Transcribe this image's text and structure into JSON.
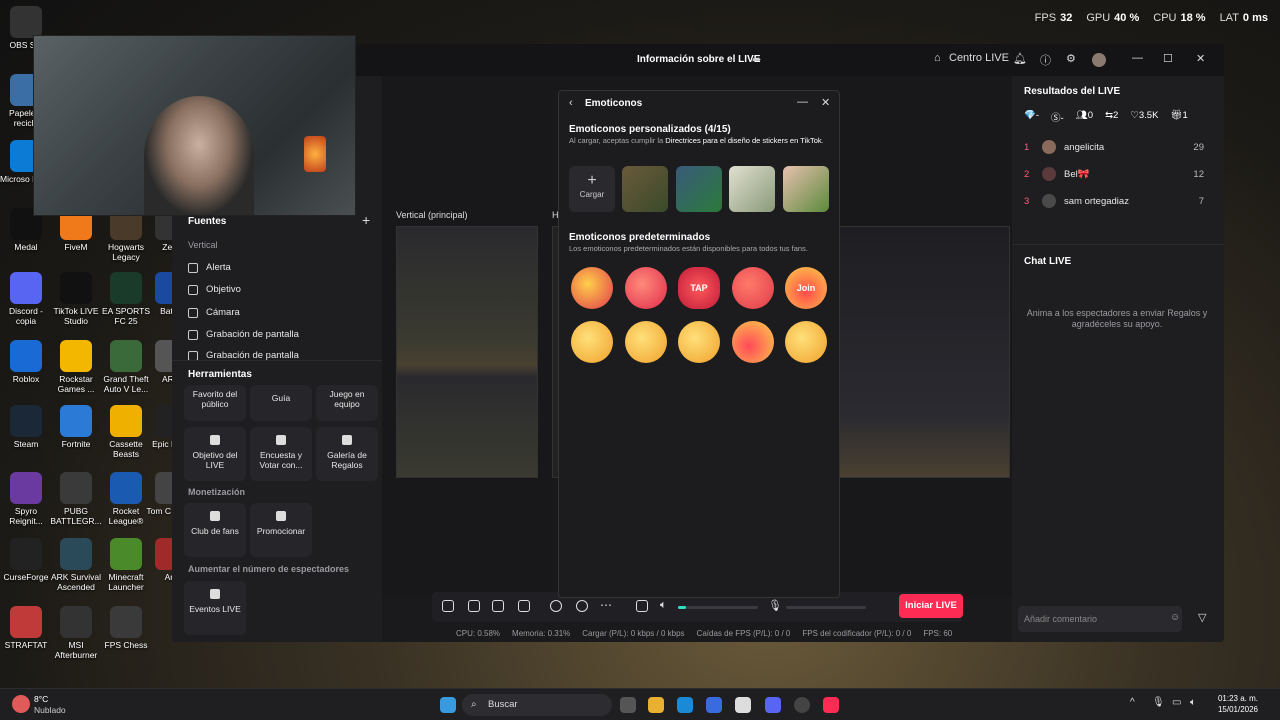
{
  "perf": {
    "fps_label": "FPS",
    "fps_value": "32",
    "gpu_label": "GPU",
    "gpu_value": "40 %",
    "cpu_label": "CPU",
    "cpu_value": "18 %",
    "lat_label": "LAT",
    "lat_value": "0 ms"
  },
  "desktop": {
    "icons": [
      {
        "label": "OBS Stu",
        "color": "#333"
      },
      {
        "label": "Papelera recicla",
        "color": "#3a6ea5"
      },
      {
        "label": "Microso Edge",
        "color": "#0c7bd6"
      },
      {
        "label": "Medal",
        "color": "#111"
      },
      {
        "label": "FiveM",
        "color": "#f07a1a"
      },
      {
        "label": "Hogwarts Legacy",
        "color": "#4a3a2a"
      },
      {
        "label": "Zero",
        "color": "#333"
      },
      {
        "label": "Discord - copia",
        "color": "#5865f2"
      },
      {
        "label": "TikTok LIVE Studio",
        "color": "#111"
      },
      {
        "label": "EA SPORTS FC 25",
        "color": "#1a3a2a"
      },
      {
        "label": "Battle",
        "color": "#1a4aa0"
      },
      {
        "label": "Roblox",
        "color": "#1a6ad6"
      },
      {
        "label": "Rockstar Games ...",
        "color": "#f3b700"
      },
      {
        "label": "Grand Theft Auto V Le...",
        "color": "#3a6a3a"
      },
      {
        "label": "ARC",
        "color": "#555"
      },
      {
        "label": "Steam",
        "color": "#1b2838"
      },
      {
        "label": "Fortnite",
        "color": "#2a7ad6"
      },
      {
        "label": "Cassette Beasts",
        "color": "#f0b000"
      },
      {
        "label": "Epic Laun",
        "color": "#222"
      },
      {
        "label": "Spyro Reignit...",
        "color": "#6a3aa0"
      },
      {
        "label": "PUBG BATTLEGR...",
        "color": "#3a3a3a"
      },
      {
        "label": "Rocket League®",
        "color": "#1a5ab0"
      },
      {
        "label": "Tom C Rainb",
        "color": "#444"
      },
      {
        "label": "CurseForge",
        "color": "#222"
      },
      {
        "label": "ARK Survival Ascended",
        "color": "#2a4a5a"
      },
      {
        "label": "Minecraft Launcher",
        "color": "#4a8a2a"
      },
      {
        "label": "Am",
        "color": "#a02a2a"
      },
      {
        "label": "STRAFTAT",
        "color": "#c03a3a"
      },
      {
        "label": "MSI Afterburner",
        "color": "#333"
      },
      {
        "label": "FPS Chess",
        "color": "#3a3a3a"
      }
    ]
  },
  "window": {
    "title": "Información sobre el LIVE",
    "centro": "Centro LIVE",
    "left": {
      "fuentes": "Fuentes",
      "vertical": "Vertical",
      "sources": [
        "Alerta",
        "Objetivo",
        "Cámara",
        "Grabación de pantalla",
        "Grabación de pantalla"
      ],
      "herramientas": "Herramientas",
      "tools_row1": [
        "Favorito del público",
        "Guía",
        "Juego en equipo"
      ],
      "tools_row2": [
        "Objetivo del LIVE",
        "Encuesta y Votar con...",
        "Galería de Regalos"
      ],
      "monetizacion": "Monetización",
      "tools_row3": [
        "Club de fans",
        "Promocionar"
      ],
      "aumentar": "Aumentar el número de espectadores",
      "tools_row4": [
        "Eventos LIVE"
      ]
    },
    "canvas": {
      "vertical_label": "Vertical (principal)",
      "h_label": "H"
    },
    "right": {
      "resultados": "Resultados del LIVE",
      "stats": {
        "a": "-",
        "b": "-",
        "viewers": "0",
        "shares": "2",
        "likes": "3.5K",
        "gifts": "1"
      },
      "ranking": [
        {
          "n": "1",
          "name": "angelicita",
          "score": "29"
        },
        {
          "n": "2",
          "name": "Bel🎀",
          "score": "12"
        },
        {
          "n": "3",
          "name": "sam ortegadiaz",
          "score": "7"
        }
      ],
      "chat_title": "Chat LIVE",
      "chat_empty": "Anima a los espectadores a enviar Regalos y agradéceles su apoyo.",
      "comment_placeholder": "Añadir comentario"
    },
    "go_live": "Iniciar LIVE",
    "status": [
      "CPU: 0.58%",
      "Memoria: 0.31%",
      "Cargar (P/L): 0 kbps / 0 kbps",
      "Caídas de FPS (P/L): 0 / 0",
      "FPS del codificador (P/L): 0 / 0",
      "FPS: 60"
    ]
  },
  "modal": {
    "title": "Emoticonos",
    "custom_title": "Emoticonos personalizados (4/15)",
    "custom_desc_1": "Al cargar, aceptas cumplir la ",
    "custom_desc_link": "Directrices para el diseño de stickers en TikTok",
    "custom_desc_2": ".",
    "upload": "Cargar",
    "default_title": "Emoticonos predeterminados",
    "default_desc": "Los emoticonos predeterminados están disponibles para todos tus fans.",
    "emotes_row1": [
      "",
      "",
      "TAP",
      "",
      "Join"
    ],
    "emotes_row2": [
      "",
      "",
      "",
      "",
      ""
    ]
  },
  "taskbar": {
    "weather_temp": "8°C",
    "weather_desc": "Nublado",
    "search": "Buscar",
    "time": "01:23 a. m.",
    "date": "15/01/2026"
  }
}
